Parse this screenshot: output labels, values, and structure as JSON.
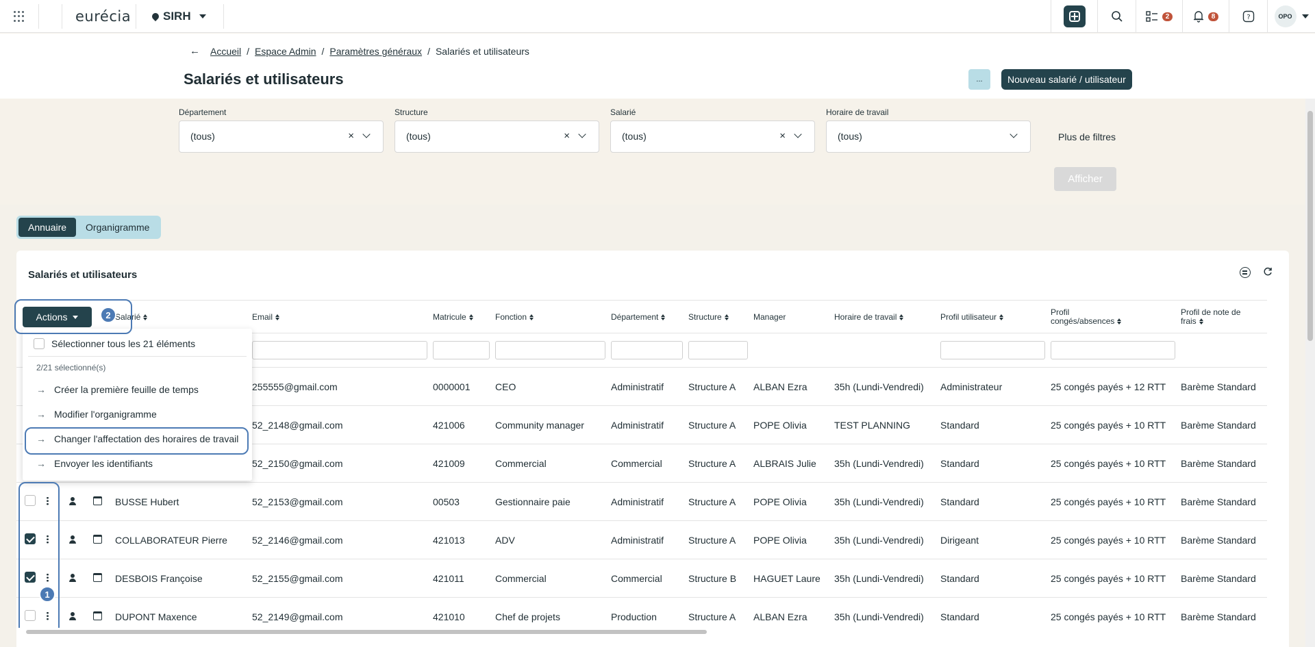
{
  "topbar": {
    "logo": "eurécia",
    "app": "SIRH",
    "tasks_badge": "2",
    "notif_badge": "8",
    "user_initials": "OPO",
    "icons": [
      "apps-grid-icon",
      "plus-square-icon",
      "search-icon",
      "checklist-icon",
      "bell-icon",
      "help-icon"
    ]
  },
  "breadcrumb": [
    "Accueil",
    "Espace Admin",
    "Paramètres généraux",
    "Salariés et utilisateurs"
  ],
  "page": {
    "title": "Salariés et utilisateurs",
    "more_label": "...",
    "new_label": "Nouveau salarié / utilisateur"
  },
  "filters": {
    "items": [
      {
        "label": "Département",
        "value": "(tous)"
      },
      {
        "label": "Structure",
        "value": "(tous)"
      },
      {
        "label": "Salarié",
        "value": "(tous)"
      },
      {
        "label": "Horaire de travail",
        "value": "(tous)"
      }
    ],
    "more": "Plus de filtres",
    "apply": "Afficher"
  },
  "views": {
    "annuaire": "Annuaire",
    "organigramme": "Organigramme"
  },
  "card": {
    "title": "Salariés et utilisateurs"
  },
  "table": {
    "headers": {
      "salarie": "Salarié",
      "email": "Email",
      "matricule": "Matricule",
      "fonction": "Fonction",
      "departement": "Département",
      "structure": "Structure",
      "manager": "Manager",
      "horaire": "Horaire de travail",
      "profil_user": "Profil utilisateur",
      "profil_conges_1": "Profil",
      "profil_conges_2": "congés/absences",
      "profil_frais_1": "Profil de note de",
      "profil_frais_2": "frais"
    },
    "rows": [
      {
        "checked": false,
        "name": "",
        "email": "255555@gmail.com",
        "matricule": "0000001",
        "fonction": "CEO",
        "departement": "Administratif",
        "structure": "Structure A",
        "manager": "ALBAN Ezra",
        "horaire": "35h (Lundi-Vendredi)",
        "profil": "Administrateur",
        "conges": "25 congés payés + 12 RTT",
        "frais": "Barème Standard"
      },
      {
        "checked": false,
        "name": "",
        "email": "52_2148@gmail.com",
        "matricule": "421006",
        "fonction": "Community manager",
        "departement": "Administratif",
        "structure": "Structure A",
        "manager": "POPE Olivia",
        "horaire": "TEST PLANNING",
        "profil": "Standard",
        "conges": "25 congés payés + 10 RTT",
        "frais": "Barème Standard"
      },
      {
        "checked": false,
        "name": "",
        "email": "52_2150@gmail.com",
        "matricule": "421009",
        "fonction": "Commercial",
        "departement": "Commercial",
        "structure": "Structure A",
        "manager": "ALBRAIS Julie",
        "horaire": "35h (Lundi-Vendredi)",
        "profil": "Standard",
        "conges": "25 congés payés + 10 RTT",
        "frais": "Barème Standard"
      },
      {
        "checked": false,
        "name": "BUSSE Hubert",
        "email": "52_2153@gmail.com",
        "matricule": "00503",
        "fonction": "Gestionnaire paie",
        "departement": "Administratif",
        "structure": "Structure A",
        "manager": "POPE Olivia",
        "horaire": "35h (Lundi-Vendredi)",
        "profil": "Standard",
        "conges": "25 congés payés + 10 RTT",
        "frais": "Barème Standard"
      },
      {
        "checked": true,
        "name": "COLLABORATEUR Pierre",
        "email": "52_2146@gmail.com",
        "matricule": "421013",
        "fonction": "ADV",
        "departement": "Administratif",
        "structure": "Structure A",
        "manager": "POPE Olivia",
        "horaire": "35h (Lundi-Vendredi)",
        "profil": "Dirigeant",
        "conges": "25 congés payés + 10 RTT",
        "frais": "Barème Standard"
      },
      {
        "checked": true,
        "name": "DESBOIS Françoise",
        "email": "52_2155@gmail.com",
        "matricule": "421011",
        "fonction": "Commercial",
        "departement": "Commercial",
        "structure": "Structure B",
        "manager": "HAGUET Laure",
        "horaire": "35h (Lundi-Vendredi)",
        "profil": "Standard",
        "conges": "25 congés payés + 10 RTT",
        "frais": "Barème Standard"
      },
      {
        "checked": false,
        "name": "DUPONT Maxence",
        "email": "52_2149@gmail.com",
        "matricule": "421010",
        "fonction": "Chef de projets",
        "departement": "Production",
        "structure": "Structure A",
        "manager": "ALBAN Ezra",
        "horaire": "35h (Lundi-Vendredi)",
        "profil": "Standard",
        "conges": "25 congés payés + 10 RTT",
        "frais": "Barème Standard"
      }
    ]
  },
  "actions": {
    "label": "Actions",
    "select_all": "Sélectionner tous les 21 éléments",
    "selected_count": "2/21 sélectionné(s)",
    "items": [
      "Créer la première feuille de temps",
      "Modifier l'organigramme",
      "Changer l'affectation des horaires de travail",
      "Envoyer les identifiants"
    ]
  },
  "annotations": {
    "step1": "1",
    "step2": "2"
  },
  "colors": {
    "primary": "#24434c",
    "accent": "#b9dde6",
    "badge": "#c0533a",
    "annotation": "#4c7ab4"
  }
}
